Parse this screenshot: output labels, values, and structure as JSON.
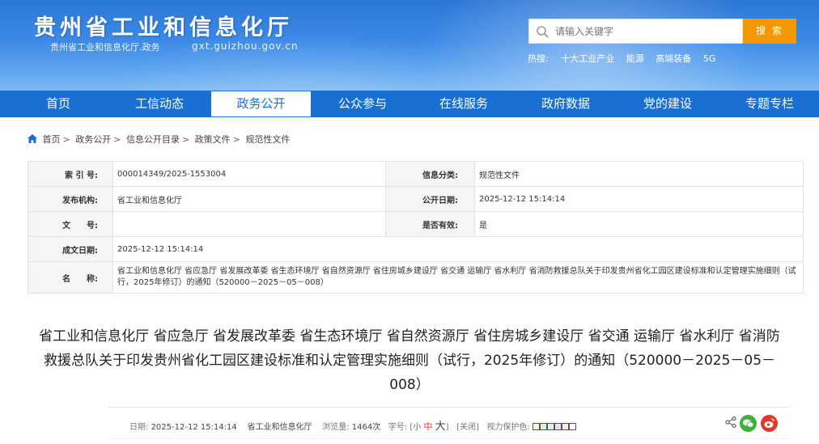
{
  "header": {
    "title": "贵州省工业和信息化厅",
    "subtitle": "贵州省工业和信息化厅.政务",
    "url": "gxt.guizhou.gov.cn"
  },
  "search": {
    "placeholder": "请输入关键字",
    "button_label": "搜 索"
  },
  "hot": {
    "label": "热搜:",
    "items": [
      "十大工业产业",
      "能源",
      "高端装备",
      "5G"
    ]
  },
  "nav": {
    "items": [
      "首页",
      "工信动态",
      "政务公开",
      "公众参与",
      "在线服务",
      "政府数据",
      "党的建设",
      "专题专栏"
    ],
    "active_index": 2
  },
  "breadcrumb": {
    "items": [
      "首页",
      "政务公开",
      "信息公开目录",
      "政策文件",
      "规范性文件"
    ],
    "separator": ">"
  },
  "info": {
    "index_label": "索 引 号:",
    "index_value": "000014349/2025-1553004",
    "category_label": "信息分类:",
    "category_value": "规范性文件",
    "publisher_label": "发布机构:",
    "publisher_value": "省工业和信息化厅",
    "pubdate_label": "公开日期:",
    "pubdate_value": "2025-12-12 15:14:14",
    "docno_label": "文　　号:",
    "docno_value": "",
    "valid_label": "是否有效:",
    "valid_value": "是",
    "written_label": "成文日期:",
    "written_value": "2025-12-12 15:14:14",
    "name_label": "名　　称:",
    "name_value": "省工业和信息化厅 省应急厅 省发展改革委 省生态环境厅 省自然资源厅 省住房城乡建设厅 省交通 运输厅 省水利厅 省消防救援总队关于印发贵州省化工园区建设标准和认定管理实施细则（试行，2025年修订）的通知（520000－2025－05－008）"
  },
  "article": {
    "title": "省工业和信息化厅 省应急厅 省发展改革委 省生态环境厅 省自然资源厅 省住房城乡建设厅 省交通 运输厅 省水利厅 省消防救援总队关于印发贵州省化工园区建设标准和认定管理实施细则（试行，2025年修订）的通知（520000－2025－05－008）"
  },
  "meta": {
    "date_label": "日期:",
    "date_value": "2025-12-12 15:14:14",
    "source_value": "省工业和信息化厅",
    "views_label": "浏览量:",
    "views_value": "1464次",
    "font_label": "字号:",
    "font_small": "小",
    "font_medium": "中",
    "font_large": "大",
    "close_label": "[关闭]",
    "vision_label": "视力保护色:"
  },
  "colors": {
    "header_blue": "#2b77d6",
    "nav_blue": "#1970d2",
    "search_orange": "#f39800",
    "swatches": [
      "#fafad2",
      "#e2f0d9",
      "#daeef3",
      "#e4dfec",
      "#fde9d9",
      "#ffffff"
    ]
  }
}
